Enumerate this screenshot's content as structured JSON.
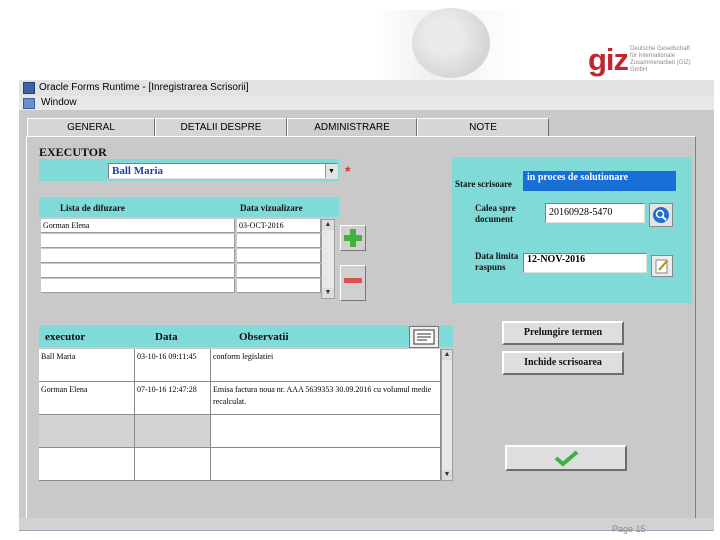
{
  "slide": {
    "logo_text": "giz",
    "logo_lines": [
      "Deutsche Gesellschaft",
      "für Internationale",
      "Zusammenarbeit (GIZ) GmbH"
    ],
    "page_label": "Page 15"
  },
  "window": {
    "title": "Oracle Forms Runtime - [Inregistrarea Scrisorii]",
    "menu": "Window"
  },
  "tabs": [
    {
      "label": "GENERAL"
    },
    {
      "label": "DETALII DESPRE EXPEDITOR"
    },
    {
      "label": "ADMINISTRARE"
    },
    {
      "label": "NOTE"
    }
  ],
  "executor": {
    "label": "EXECUTOR",
    "value": "Ball Maria",
    "required_mark": "*"
  },
  "diffusion": {
    "col_list": "Lista de difuzare",
    "col_date": "Data vizualizare",
    "rows": [
      {
        "name": "Gorman Elena",
        "date": "03-OCT-2016"
      },
      {
        "name": "",
        "date": ""
      },
      {
        "name": "",
        "date": ""
      },
      {
        "name": "",
        "date": ""
      },
      {
        "name": "",
        "date": ""
      }
    ]
  },
  "status_panel": {
    "stare_label": "Stare scrisoare",
    "stare_value": "in proces de solutionare",
    "calea_label": "Calea spre document",
    "calea_value": "20160928-5470",
    "data_limita_label": "Data limita raspuns",
    "data_limita_value": "12-NOV-2016"
  },
  "history": {
    "col_executor": "executor",
    "col_data": "Data",
    "col_obs": "Observatii",
    "rows": [
      {
        "executor": "Ball Maria",
        "data": "03-10-16 09:11:45",
        "obs": "conform legislatiei"
      },
      {
        "executor": "Gorman Elena",
        "data": "07-10-16 12:47:28",
        "obs": "Emisa factura noua nr. AAA 5639353 30.09.2016 cu volumul medie recalculat."
      },
      {
        "executor": "",
        "data": "",
        "obs": ""
      },
      {
        "executor": "",
        "data": "",
        "obs": ""
      }
    ]
  },
  "buttons": {
    "prelungire": "Prelungire termen",
    "inchide": "Inchide scrisoarea"
  },
  "colors": {
    "cyan": "#7fdad8",
    "selection_blue": "#1a6fd6",
    "add_green": "#3fb23f",
    "remove_red": "#d9534f",
    "giz_red": "#c0262d"
  }
}
